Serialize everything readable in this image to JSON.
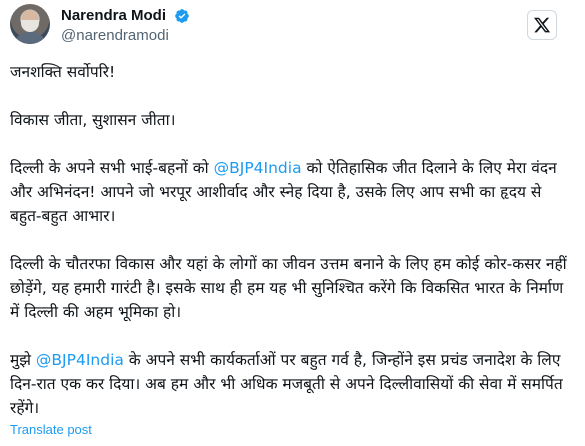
{
  "author": {
    "display_name": "Narendra Modi",
    "handle": "@narendramodi"
  },
  "colors": {
    "text": "#0f1419",
    "secondary": "#536471",
    "link": "#1d9bf0",
    "verified": "#1d9bf0"
  },
  "icons": {
    "verified": "verified-badge-icon",
    "logo": "x-logo-icon"
  },
  "tweet": {
    "p1": "जनशक्ति सर्वोपरि!",
    "p2": "विकास जीता, सुशासन जीता।",
    "p3_before": "दिल्ली के अपने सभी भाई-बहनों को ",
    "p3_mention": "@BJP4India",
    "p3_after": " को ऐतिहासिक जीत दिलाने के लिए मेरा वंदन और अभिनंदन! आपने जो भरपूर आशीर्वाद और स्नेह दिया है, उसके लिए आप सभी का हृदय से बहुत-बहुत आभार।",
    "p4": "दिल्ली के चौतरफा विकास और यहां के लोगों का जीवन उत्तम बनाने के लिए हम कोई कोर-कसर नहीं छोड़ेंगे, यह हमारी गारंटी है। इसके साथ ही हम यह भी सुनिश्चित करेंगे कि विकसित भारत के निर्माण में दिल्ली की अहम भूमिका हो।",
    "p5_before": "मुझे ",
    "p5_mention": "@BJP4India",
    "p5_after": " के अपने सभी कार्यकर्ताओं पर बहुत गर्व है, जिन्होंने इस प्रचंड जनादेश के लिए दिन-रात एक कर दिया। अब हम और भी अधिक मजबूती से अपने दिल्लीवासियों की सेवा में समर्पित रहेंगे।"
  },
  "translate_label": "Translate post"
}
